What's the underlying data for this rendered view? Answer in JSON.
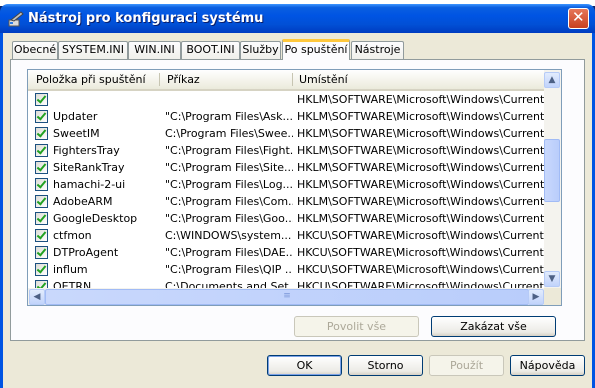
{
  "window": {
    "title": "Nástroj pro konfiguraci systému",
    "close_symbol": "✕"
  },
  "tabs": [
    {
      "label": "Obecné",
      "active": false
    },
    {
      "label": "SYSTEM.INI",
      "active": false
    },
    {
      "label": "WIN.INI",
      "active": false
    },
    {
      "label": "BOOT.INI",
      "active": false
    },
    {
      "label": "Služby",
      "active": false
    },
    {
      "label": "Po spuštění",
      "active": true
    },
    {
      "label": "Nástroje",
      "active": false
    }
  ],
  "list": {
    "headers": [
      "Položka při spuštění",
      "Příkaz",
      "Umístění"
    ],
    "rows": [
      {
        "checked": true,
        "item": "",
        "command": "",
        "location": "HKLM\\SOFTWARE\\Microsoft\\Windows\\CurrentVer..."
      },
      {
        "checked": true,
        "item": "Updater",
        "command": "\"C:\\Program Files\\Ask....",
        "location": "HKLM\\SOFTWARE\\Microsoft\\Windows\\CurrentVer..."
      },
      {
        "checked": true,
        "item": "SweetIM",
        "command": "C:\\Program Files\\Swee...",
        "location": "HKLM\\SOFTWARE\\Microsoft\\Windows\\CurrentVer..."
      },
      {
        "checked": true,
        "item": "FightersTray",
        "command": "\"C:\\Program Files\\Fight...",
        "location": "HKLM\\SOFTWARE\\Microsoft\\Windows\\CurrentVer..."
      },
      {
        "checked": true,
        "item": "SiteRankTray",
        "command": "\"C:\\Program Files\\Site...",
        "location": "HKLM\\SOFTWARE\\Microsoft\\Windows\\CurrentVer..."
      },
      {
        "checked": true,
        "item": "hamachi-2-ui",
        "command": "\"C:\\Program Files\\Log...",
        "location": "HKLM\\SOFTWARE\\Microsoft\\Windows\\CurrentVer..."
      },
      {
        "checked": true,
        "item": "AdobeARM",
        "command": "\"C:\\Program Files\\Com...",
        "location": "HKLM\\SOFTWARE\\Microsoft\\Windows\\CurrentVer..."
      },
      {
        "checked": true,
        "item": "GoogleDesktop",
        "command": "\"C:\\Program Files\\Goo...",
        "location": "HKLM\\SOFTWARE\\Microsoft\\Windows\\CurrentVer..."
      },
      {
        "checked": true,
        "item": "ctfmon",
        "command": "C:\\WINDOWS\\system...",
        "location": "HKCU\\SOFTWARE\\Microsoft\\Windows\\CurrentVer..."
      },
      {
        "checked": true,
        "item": "DTProAgent",
        "command": "\"C:\\Program Files\\DAE...",
        "location": "HKCU\\SOFTWARE\\Microsoft\\Windows\\CurrentVer..."
      },
      {
        "checked": true,
        "item": "influm",
        "command": "\"C:\\Program Files\\QIP ...",
        "location": "HKCU\\SOFTWARE\\Microsoft\\Windows\\CurrentVer..."
      },
      {
        "checked": true,
        "item": "OETRN",
        "command": "C:\\Documents and Set...",
        "location": "HKCU\\SOFTWARE\\Microsoft\\Windows\\CurrentVer..."
      }
    ]
  },
  "panel_buttons": {
    "enable_all": "Povolit vše",
    "disable_all": "Zakázat vše"
  },
  "dialog_buttons": {
    "ok": "OK",
    "cancel": "Storno",
    "apply": "Použít",
    "help": "Nápověda"
  },
  "icons": {
    "scroll_up": "▲",
    "scroll_down": "▼",
    "scroll_left": "◀",
    "scroll_right": "▶",
    "grip": "≡"
  }
}
